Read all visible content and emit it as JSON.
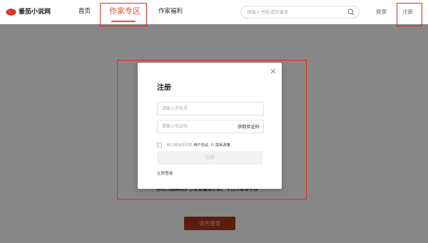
{
  "header": {
    "logo_text": "番茄小说网",
    "nav": {
      "home": "首页",
      "author_zone": "作家专区",
      "welfare": "作家福利"
    },
    "search_placeholder": "请输入书名或作者名",
    "login": "登录",
    "register": "注册"
  },
  "background": {
    "text": "你的作品将同步分发至番茄小说、今日头条等平台",
    "cta": "请先登录"
  },
  "modal": {
    "title": "注册",
    "phone_placeholder": "请输入手机号",
    "code_placeholder": "请输入验证码",
    "get_code": "获取验证码",
    "agree_prefix": "我已阅读并同意",
    "user_agreement": "用户协议",
    "and": "和",
    "privacy_policy": "隐私政策",
    "register_button": "注册",
    "quick_login": "立即登录"
  },
  "colors": {
    "accent": "#e0502b",
    "highlight": "#e8281c"
  }
}
